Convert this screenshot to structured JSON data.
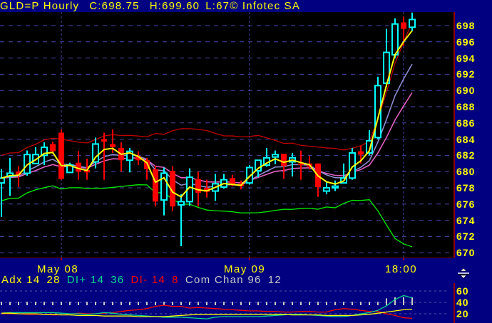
{
  "header": {
    "symbol": "GLD=P Hourly",
    "close": "C:698.75",
    "high": "H:699.60",
    "low": "L:67",
    "vendor": "© Infotec SA"
  },
  "indicator_legend": {
    "adx_label": "Adx 14",
    "adx_value": "28",
    "diplus_label": "DI+ 14",
    "diplus_value": "36",
    "diminus_label": "DI- 14",
    "diminus_value": "8",
    "comchan_label": "Com Chan 96",
    "comchan_value": "12"
  },
  "colors": {
    "up": "#00ffff",
    "down": "#ff0000",
    "fast_ma": "#ffff00",
    "mid_ma": "#8c8cd0",
    "slow_ma": "#e060c0",
    "upper_band": "#c00000",
    "lower_band": "#00ee00",
    "adx": "#ffff00",
    "diplus": "#00d890",
    "diminus": "#ff0000",
    "comchan": "#c8c8c8"
  },
  "chart_data": [
    {
      "type": "candlestick",
      "title": "GLD=P Hourly",
      "ylim": [
        669,
        700
      ],
      "y_ticks": [
        "698",
        "696",
        "694",
        "692",
        "690",
        "688",
        "686",
        "684",
        "682",
        "680",
        "678",
        "676",
        "674",
        "672",
        "670"
      ],
      "x_labels": [
        {
          "label": "May 08",
          "index": 7
        },
        {
          "label": "May 09",
          "index": 29
        },
        {
          "label": "18:00",
          "index": 47
        }
      ],
      "ohlc": [
        [
          678.6,
          680.3,
          674.4,
          679.2
        ],
        [
          679.4,
          681.7,
          677.0,
          679.8
        ],
        [
          680.0,
          680.7,
          678.1,
          679.6
        ],
        [
          679.8,
          682.6,
          679.5,
          682.1
        ],
        [
          681.0,
          683.0,
          681.0,
          682.1
        ],
        [
          682.0,
          683.6,
          680.8,
          683.0
        ],
        [
          683.4,
          683.7,
          682.2,
          682.5
        ],
        [
          684.8,
          685.2,
          679.0,
          679.1
        ],
        [
          679.9,
          681.1,
          679.8,
          680.8
        ],
        [
          681.1,
          682.5,
          679.0,
          680.0
        ],
        [
          680.2,
          681.6,
          679.0,
          679.9
        ],
        [
          681.2,
          684.2,
          680.4,
          683.4
        ],
        [
          684.0,
          684.8,
          679.0,
          683.7
        ],
        [
          683.4,
          685.2,
          682.3,
          683.0
        ],
        [
          682.9,
          683.6,
          680.0,
          681.4
        ],
        [
          681.4,
          682.9,
          679.9,
          682.5
        ],
        [
          681.9,
          682.5,
          680.8,
          681.4
        ],
        [
          681.4,
          681.7,
          679.0,
          680.3
        ],
        [
          680.3,
          680.7,
          675.7,
          676.3
        ],
        [
          676.5,
          680.5,
          674.6,
          679.8
        ],
        [
          680.1,
          680.7,
          675.1,
          675.7
        ],
        [
          675.9,
          677.2,
          670.8,
          676.3
        ],
        [
          676.3,
          680.4,
          675.8,
          679.3
        ],
        [
          679.1,
          680.0,
          675.7,
          677.4
        ],
        [
          678.0,
          679.0,
          676.8,
          677.5
        ],
        [
          677.6,
          679.7,
          676.4,
          678.5
        ],
        [
          678.1,
          679.7,
          677.9,
          679.0
        ],
        [
          679.2,
          679.6,
          678.2,
          678.3
        ],
        [
          678.5,
          678.9,
          677.8,
          678.2
        ],
        [
          678.6,
          680.8,
          678.4,
          680.5
        ],
        [
          680.1,
          681.4,
          679.3,
          681.4
        ],
        [
          680.8,
          682.9,
          680.6,
          681.7
        ],
        [
          681.8,
          682.6,
          680.9,
          682.1
        ],
        [
          682.2,
          682.2,
          679.1,
          680.7
        ],
        [
          681.2,
          682.3,
          679.4,
          681.7
        ],
        [
          681.0,
          682.6,
          679.0,
          680.8
        ],
        [
          681.0,
          681.9,
          680.3,
          680.6
        ],
        [
          681.0,
          681.0,
          676.9,
          678.1
        ],
        [
          677.6,
          678.7,
          677.2,
          678.0
        ],
        [
          678.0,
          678.9,
          677.6,
          678.2
        ],
        [
          678.6,
          681.0,
          678.6,
          679.2
        ],
        [
          679.2,
          682.9,
          679.0,
          682.3
        ],
        [
          682.5,
          683.2,
          681.0,
          682.1
        ],
        [
          682.3,
          685.1,
          682.0,
          683.8
        ],
        [
          684.2,
          691.7,
          684.0,
          690.6
        ],
        [
          690.9,
          697.6,
          690.5,
          694.7
        ],
        [
          694.4,
          698.9,
          694.0,
          698.2
        ],
        [
          698.4,
          699.1,
          695.5,
          697.6
        ],
        [
          697.8,
          699.6,
          697.3,
          698.75
        ]
      ]
    },
    {
      "type": "line",
      "title": "ADX / DMI / Commodity Channel",
      "ylim": [
        10,
        65
      ],
      "y_ticks": [
        "60",
        "40",
        "20"
      ],
      "series": [
        {
          "name": "Adx 14",
          "values": [
            21,
            21,
            20,
            20,
            20,
            19,
            19,
            18,
            18,
            17,
            17,
            17,
            16,
            16,
            16,
            16,
            15,
            15,
            15,
            15,
            16,
            17,
            18,
            19,
            19,
            19,
            19,
            19,
            19,
            19,
            19,
            19,
            19,
            19,
            18,
            18,
            18,
            18,
            17,
            17,
            17,
            17,
            18,
            19,
            21,
            23,
            25,
            27,
            28
          ]
        },
        {
          "name": "DI+ 14",
          "values": [
            21,
            22,
            22,
            22,
            22,
            22,
            22,
            21,
            20,
            20,
            19,
            20,
            22,
            21,
            19,
            18,
            17,
            16,
            15,
            14,
            14,
            14,
            13,
            12,
            11,
            14,
            15,
            15,
            15,
            15,
            15,
            16,
            17,
            18,
            19,
            19,
            18,
            17,
            16,
            15,
            15,
            17,
            20,
            22,
            26,
            34,
            45,
            52,
            48
          ]
        },
        {
          "name": "DI- 14",
          "values": [
            20,
            20,
            20,
            19,
            19,
            19,
            18,
            18,
            19,
            21,
            20,
            20,
            21,
            22,
            24,
            26,
            27,
            29,
            33,
            35,
            33,
            33,
            30,
            31,
            30,
            29,
            28,
            27,
            26,
            25,
            25,
            24,
            24,
            23,
            23,
            24,
            24,
            23,
            23,
            27,
            29,
            28,
            26,
            24,
            24,
            20,
            17,
            13,
            12
          ]
        },
        {
          "name": "Com Chan 96",
          "values": [
            41,
            41,
            41,
            41,
            41,
            41,
            41,
            41,
            41,
            41,
            41,
            41,
            41,
            41,
            41,
            41,
            41,
            41,
            41,
            41,
            41,
            41,
            41,
            41,
            41,
            41,
            41,
            41,
            41,
            41,
            41,
            41,
            41,
            41,
            41,
            41,
            41,
            41,
            41,
            41,
            41,
            41,
            41,
            41,
            41,
            47,
            49,
            49,
            49
          ]
        }
      ]
    }
  ]
}
